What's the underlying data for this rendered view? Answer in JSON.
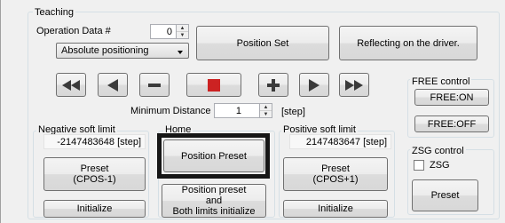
{
  "teaching": {
    "title": "Teaching",
    "operation_data_label": "Operation Data #",
    "operation_data_value": "0",
    "mode_select": "Absolute positioning",
    "position_set_label": "Position Set",
    "reflecting_label": "Reflecting on the driver.",
    "jog_buttons": [
      {
        "name": "fast-reverse-icon",
        "symbol": "fast-reverse"
      },
      {
        "name": "reverse-icon",
        "symbol": "reverse"
      },
      {
        "name": "minus-icon",
        "symbol": "minus"
      },
      {
        "name": "stop-icon",
        "symbol": "stop",
        "color": "#cc2222"
      },
      {
        "name": "plus-icon",
        "symbol": "plus"
      },
      {
        "name": "forward-icon",
        "symbol": "forward"
      },
      {
        "name": "fast-forward-icon",
        "symbol": "fast-forward"
      }
    ],
    "min_distance_label": "Minimum Distance",
    "min_distance_value": "1",
    "min_distance_unit": "[step]"
  },
  "negative_soft_limit": {
    "title": "Negative soft limit",
    "value": "-2147483648",
    "unit": "[step]",
    "preset_label_1": "Preset",
    "preset_label_2": "(CPOS-1)",
    "initialize_label": "Initialize"
  },
  "home": {
    "title": "Home",
    "position_preset_label": "Position Preset",
    "both_label_1": "Position preset",
    "both_label_2": "and",
    "both_label_3": "Both limits initialize"
  },
  "positive_soft_limit": {
    "title": "Positive soft limit",
    "value": "2147483647",
    "unit": "[step]",
    "preset_label_1": "Preset",
    "preset_label_2": "(CPOS+1)",
    "initialize_label": "Initialize"
  },
  "free_control": {
    "title": "FREE control",
    "free_on_label": "FREE:ON",
    "free_off_label": "FREE:OFF"
  },
  "zsg_control": {
    "title": "ZSG control",
    "checkbox_label": "ZSG",
    "checked": false,
    "preset_label": "Preset"
  },
  "colors": {
    "highlight": "#161616",
    "stop": "#cc2222",
    "background": "#f0f0f0"
  }
}
